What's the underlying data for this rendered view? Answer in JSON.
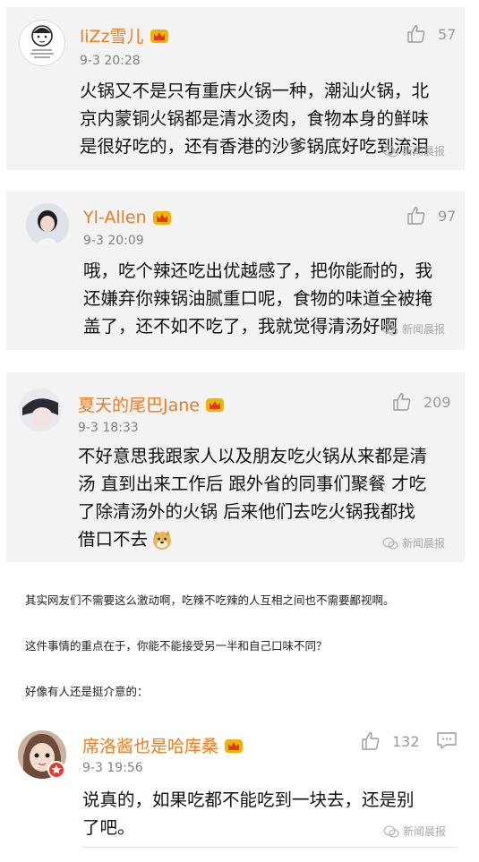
{
  "comments": [
    {
      "username": "liZz雪儿",
      "timestamp": "9-3 20:28",
      "likes": "57",
      "text_lines": [
        "火锅又不是只有重庆火锅一种，潮汕火锅，北",
        "京内蒙铜火锅都是清水烫肉，食物本身的鲜味",
        "是很好吃的，还有香港的沙爹锅底好吃到流泪"
      ],
      "watermark": "新闻晨报",
      "badge": "crown-icon"
    },
    {
      "username": "Yl-Allen",
      "timestamp": "9-3 20:09",
      "likes": "97",
      "text_lines": [
        "哦，吃个辣还吃出优越感了，把你能耐的，我",
        "还嫌弃你辣锅油腻重口呢，食物的味道全被掩",
        "盖了，还不如不吃了，我就觉得清汤好啊"
      ],
      "watermark": "新闻晨报",
      "badge": "crown-icon"
    },
    {
      "username": "夏天的尾巴Jane",
      "timestamp": "9-3 18:33",
      "likes": "209",
      "text_lines": [
        "不好意思我跟家人以及朋友吃火锅从来都是清",
        "汤 直到出来工作后 跟外省的同事们聚餐 才吃",
        "了除清汤外的火锅 后来他们去吃火锅我都找",
        "借口不去"
      ],
      "watermark": "新闻晨报",
      "badge": "crown-icon",
      "emoji": "doge-emoji"
    },
    {
      "username": "席洛酱也是哈库桑",
      "timestamp": "9-3 19:56",
      "likes": "132",
      "text_lines": [
        "说真的，如果吃都不能吃到一块去，还是别",
        "了吧。"
      ],
      "watermark": "新闻晨报",
      "badge": "crown-icon"
    }
  ],
  "article": {
    "paragraphs": [
      "其实网友们不需要这么激动啊，吃辣不吃辣的人互相之间也不需要鄙视啊。",
      "这件事情的重点在于，你能不能接受另一半和自己口味不同？",
      "好像有人还是挺介意的："
    ]
  },
  "colors": {
    "username": "#ea7d1f",
    "card_background": "#f3f3f3",
    "meta": "#808080",
    "crown": "#f0b400"
  },
  "icons": {
    "like": "thumbs-up-icon",
    "comment": "comment-icon",
    "watermark": "wechat-icon"
  }
}
